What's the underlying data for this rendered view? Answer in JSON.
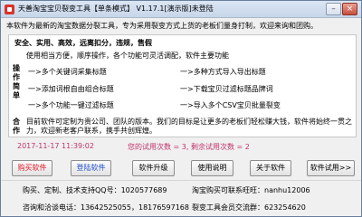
{
  "window": {
    "title": "天善淘宝宝贝裂变工具【单条模式】  V1.17.1[演示版]未登陆",
    "minimize_glyph": "–",
    "close_glyph": "×"
  },
  "intro": "本软件为最新的淘宝数据分裂工具，专为采用裂变方式上货的老板们量身打制，欢迎来询和团购。",
  "features": {
    "heading": "安全、实用、高效，远离扣分，违规，售假",
    "side_ops": "操作简单",
    "side_co": "合作",
    "guide": "使用相当方便，顺序操作，各个功能可灵活调配，软件主要功能",
    "items": [
      "一>多个关键词采集标题",
      "一>多种方式导入导出标题",
      "一>添加词根自由组合标题",
      "一>下载宝贝过滤标题品牌词",
      "一>多个功能一键过滤标题",
      "一>导入多个CSV宝贝批量裂变"
    ],
    "coop": "目前软件可定制为贵公司、团队的版本。我们的目标是让更多的老板们轻松赚大钱，软件将始终一贯之力，欢迎新老客户联系，携手共创辉煌。"
  },
  "status": {
    "datetime": "2017-11-17 11:39:02",
    "trial": "您的试用次数 = 3, 剩余试用次数 = 2"
  },
  "buttons": {
    "buy": "购买软件",
    "login": "登陆软件",
    "upgrade": "软件升级",
    "manual": "使用说明",
    "about": "关于软件",
    "trial": "软件试用>>"
  },
  "contact": {
    "qq": "购买、定制、技术支持QQ号：1020577689",
    "wangwang": "淘宝购买可联系旺旺：nanhu12006",
    "phone": "咨询和洽谈电话：13642525055，18176597168",
    "group": "裂变工具会员交流群：623254620"
  },
  "colors": {
    "accent_red": "#e21a2a",
    "accent_blue": "#1e4fd0",
    "status_pink": "#c0336b"
  }
}
